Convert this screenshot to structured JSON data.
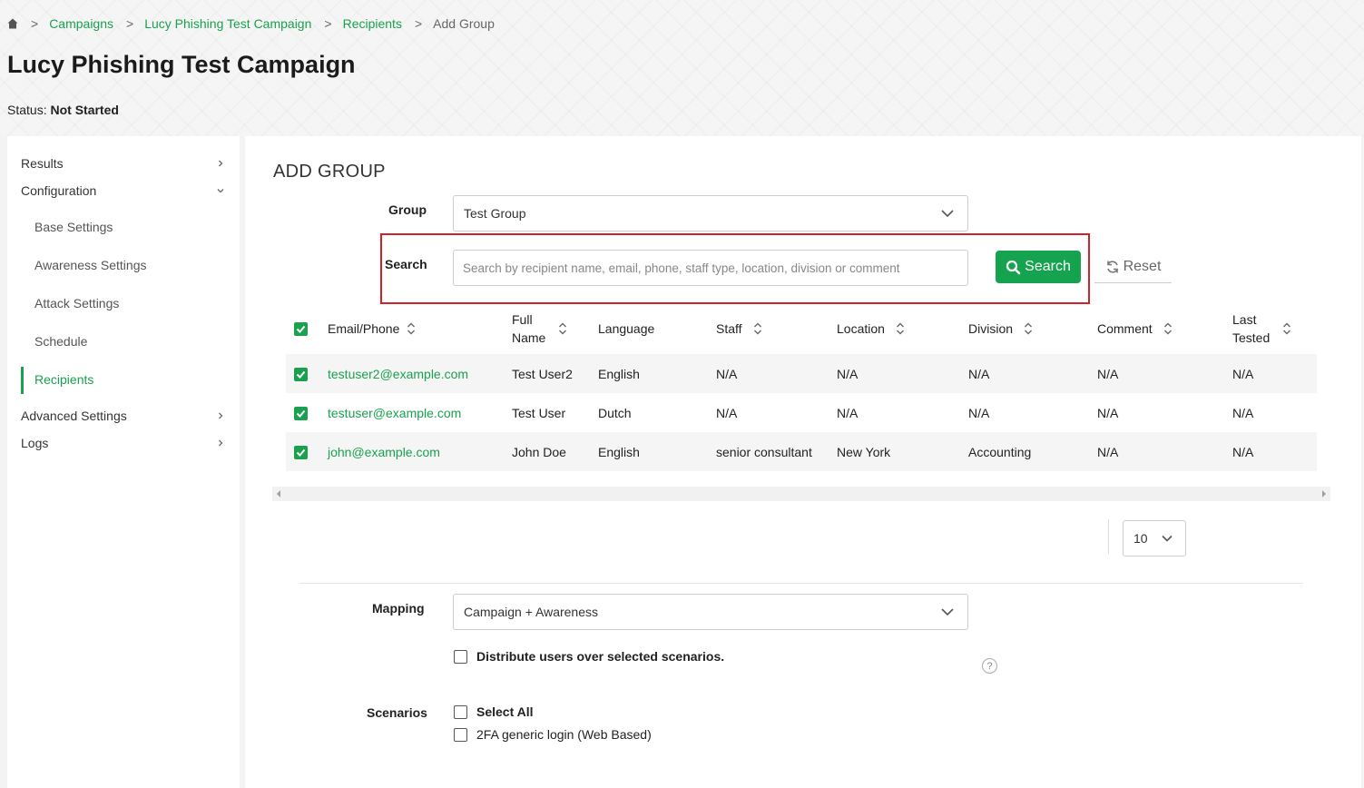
{
  "breadcrumb": {
    "separator": ">",
    "items": [
      "Campaigns",
      "Lucy Phishing Test Campaign",
      "Recipients",
      "Add Group"
    ]
  },
  "header": {
    "title": "Lucy Phishing Test Campaign",
    "status_label": "Status:",
    "status_value": "Not Started"
  },
  "sidebar": {
    "results": "Results",
    "configuration": "Configuration",
    "sub_items": [
      "Base Settings",
      "Awareness Settings",
      "Attack Settings",
      "Schedule",
      "Recipients"
    ],
    "active": "Recipients",
    "advanced": "Advanced Settings",
    "logs": "Logs"
  },
  "form": {
    "section_title": "ADD GROUP",
    "group_label": "Group",
    "group_value": "Test Group",
    "search_label": "Search",
    "search_placeholder": "Search by recipient name, email, phone, staff type, location, division or comment",
    "search_button": "Search",
    "reset_button": "Reset",
    "mapping_label": "Mapping",
    "mapping_value": "Campaign + Awareness",
    "distribute_label": "Distribute users over selected scenarios.",
    "help_glyph": "?",
    "scenarios_label": "Scenarios",
    "select_all": "Select All",
    "scenario_1": "2FA generic login (Web Based)"
  },
  "table": {
    "headers": {
      "email": "Email/Phone",
      "fullname_1": "Full",
      "fullname_2": "Name",
      "language": "Language",
      "staff": "Staff",
      "location": "Location",
      "division": "Division",
      "comment": "Comment",
      "last_1": "Last",
      "last_2": "Tested"
    },
    "rows": [
      {
        "email": "testuser2@example.com",
        "name": "Test User2",
        "language": "English",
        "staff": "N/A",
        "location": "N/A",
        "division": "N/A",
        "comment": "N/A",
        "last": "N/A"
      },
      {
        "email": "testuser@example.com",
        "name": "Test User",
        "language": "Dutch",
        "staff": "N/A",
        "location": "N/A",
        "division": "N/A",
        "comment": "N/A",
        "last": "N/A"
      },
      {
        "email": "john@example.com",
        "name": "John Doe",
        "language": "English",
        "staff": "senior consultant",
        "location": "New York",
        "division": "Accounting",
        "comment": "N/A",
        "last": "N/A"
      }
    ]
  },
  "pagination": {
    "page_size": "10"
  },
  "colors": {
    "accent": "#1aa14f",
    "button": "#16a34f",
    "highlight": "#d0202a"
  }
}
